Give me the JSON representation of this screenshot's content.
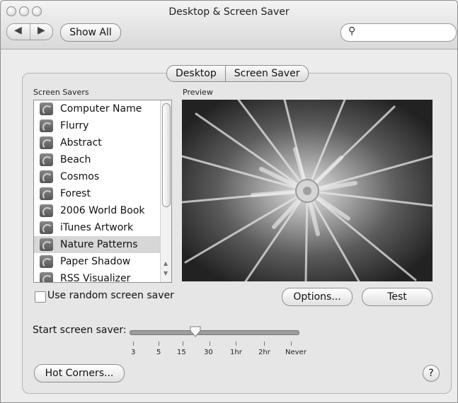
{
  "window": {
    "title": "Desktop & Screen Saver",
    "nav_back": "◀",
    "nav_forward": "▶",
    "show_all_label": "Show All",
    "search_placeholder": "",
    "search_icon": "search-icon"
  },
  "tabs": {
    "desktop": "Desktop",
    "screen_saver": "Screen Saver"
  },
  "sections": {
    "screen_savers_label": "Screen Savers",
    "preview_label": "Preview"
  },
  "screen_savers": [
    {
      "label": "Computer Name"
    },
    {
      "label": "Flurry"
    },
    {
      "label": "Abstract"
    },
    {
      "label": "Beach"
    },
    {
      "label": "Cosmos"
    },
    {
      "label": "Forest"
    },
    {
      "label": "2006 World Book"
    },
    {
      "label": "iTunes Artwork"
    },
    {
      "label": "Nature Patterns",
      "selected": true
    },
    {
      "label": "Paper Shadow"
    },
    {
      "label": "RSS Visualizer"
    }
  ],
  "options": {
    "random_label": "Use random screen saver",
    "random_checked": false,
    "options_button": "Options...",
    "test_button": "Test"
  },
  "slider": {
    "label": "Start screen saver:",
    "tick_labels": [
      "3",
      "5",
      "15",
      "30",
      "1hr",
      "2hr",
      "Never"
    ],
    "selected_tick_index": 2
  },
  "hot_corners_button": "Hot Corners...",
  "help_label": "?"
}
